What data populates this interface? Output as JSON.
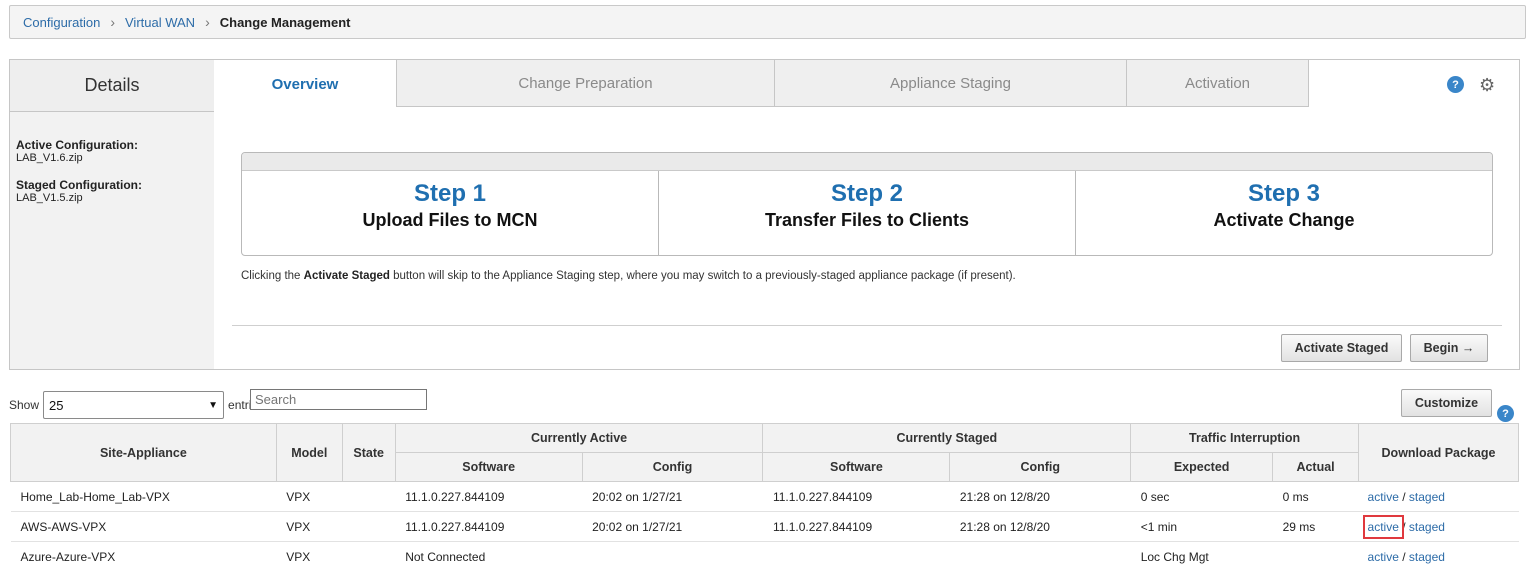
{
  "breadcrumb": {
    "items": [
      "Configuration",
      "Virtual WAN"
    ],
    "current": "Change Management"
  },
  "details": {
    "title": "Details",
    "active_label": "Active Configuration:",
    "active_value": "LAB_V1.6.zip",
    "staged_label": "Staged Configuration:",
    "staged_value": "LAB_V1.5.zip"
  },
  "tabs": [
    "Overview",
    "Change Preparation",
    "Appliance Staging",
    "Activation"
  ],
  "steps": [
    {
      "num": "Step 1",
      "title": "Upload Files to MCN"
    },
    {
      "num": "Step 2",
      "title": "Transfer Files to Clients"
    },
    {
      "num": "Step 3",
      "title": "Activate Change"
    }
  ],
  "note": {
    "prefix": "Clicking the ",
    "bold": "Activate Staged",
    "suffix": " button will skip to the Appliance Staging step, where you may switch to a previously-staged appliance package (if present)."
  },
  "buttons": {
    "activate_staged": "Activate Staged",
    "begin": "Begin →",
    "customize": "Customize"
  },
  "icons": {
    "help": "help-icon",
    "settings": "gear-icon",
    "dropdown": "chevron-down-icon"
  },
  "controls": {
    "show_label": "Show",
    "entries_value": "25",
    "entries_label": "entries",
    "search_placeholder": "Search"
  },
  "table": {
    "group_headers": [
      "Currently Active",
      "Currently Staged",
      "Traffic Interruption"
    ],
    "headers": [
      "Site-Appliance",
      "Model",
      "State",
      "Download Package"
    ],
    "sub_headers": [
      "Software",
      "Config",
      "Software",
      "Config",
      "Expected",
      "Actual"
    ],
    "rows": [
      {
        "site": "Home_Lab-Home_Lab-VPX",
        "model": "VPX",
        "state": "",
        "active_sw": "11.1.0.227.844109",
        "active_cfg": "20:02 on 1/27/21",
        "staged_sw": "11.1.0.227.844109",
        "staged_cfg": "21:28 on 12/8/20",
        "expected": "0 sec",
        "actual": "0 ms",
        "dl_active": "active",
        "dl_sep": " / ",
        "dl_staged": "staged"
      },
      {
        "site": "AWS-AWS-VPX",
        "model": "VPX",
        "state": "",
        "active_sw": "11.1.0.227.844109",
        "active_cfg": "20:02 on 1/27/21",
        "staged_sw": "11.1.0.227.844109",
        "staged_cfg": "21:28 on 12/8/20",
        "expected": "<1 min",
        "actual": "29 ms",
        "dl_active": "active",
        "dl_sep": " / ",
        "dl_staged": "staged"
      },
      {
        "site": "Azure-Azure-VPX",
        "model": "VPX",
        "state": "",
        "active_sw": "Not Connected",
        "active_cfg": "",
        "staged_sw": "",
        "staged_cfg": "",
        "expected": "Loc Chg Mgt",
        "actual": "",
        "dl_active": "active",
        "dl_sep": " / ",
        "dl_staged": "staged"
      }
    ]
  },
  "colors": {
    "accent": "#1f6fb0",
    "link": "#2d6ca8",
    "highlight": "#e0393e"
  }
}
